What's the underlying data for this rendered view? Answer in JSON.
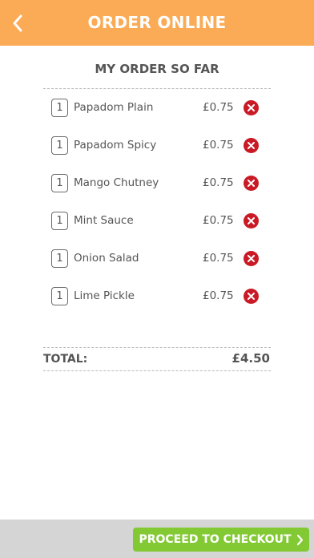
{
  "header": {
    "title": "ORDER ONLINE",
    "back_icon": "chevron-left-icon"
  },
  "order": {
    "section_title": "MY ORDER SO FAR",
    "currency": "£",
    "items": [
      {
        "qty": "1",
        "name": "Papadom Plain",
        "price": "£0.75"
      },
      {
        "qty": "1",
        "name": "Papadom Spicy",
        "price": "£0.75"
      },
      {
        "qty": "1",
        "name": "Mango Chutney",
        "price": "£0.75"
      },
      {
        "qty": "1",
        "name": "Mint Sauce",
        "price": "£0.75"
      },
      {
        "qty": "1",
        "name": "Onion Salad",
        "price": "£0.75"
      },
      {
        "qty": "1",
        "name": "Lime Pickle",
        "price": "£0.75"
      }
    ],
    "remove_icon": "remove-icon",
    "total_label": "TOTAL:",
    "total_value": "£4.50"
  },
  "footer": {
    "checkout_label": "PROCEED TO CHECKOUT",
    "checkout_icon": "chevron-right-icon"
  },
  "colors": {
    "header": "#fbaa55",
    "remove": "#c91a25",
    "checkout": "#83c934",
    "footer": "#d5d5d5"
  }
}
